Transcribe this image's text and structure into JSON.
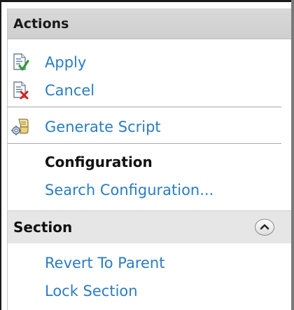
{
  "panel": {
    "title": "Actions",
    "items": {
      "apply": {
        "label": "Apply",
        "icon": "document-check-icon"
      },
      "cancel": {
        "label": "Cancel",
        "icon": "document-x-icon"
      },
      "generate_script": {
        "label": "Generate Script",
        "icon": "script-icon"
      }
    },
    "configuration": {
      "heading": "Configuration",
      "search": {
        "label": "Search Configuration..."
      }
    },
    "section": {
      "title": "Section",
      "collapse_icon": "chevron-up-icon",
      "items": {
        "revert": {
          "label": "Revert To Parent"
        },
        "lock": {
          "label": "Lock Section"
        }
      }
    }
  },
  "colors": {
    "link": "#2a7cc4",
    "header_bg": "#d6d6d6",
    "section_bg": "#e6e6e6"
  }
}
